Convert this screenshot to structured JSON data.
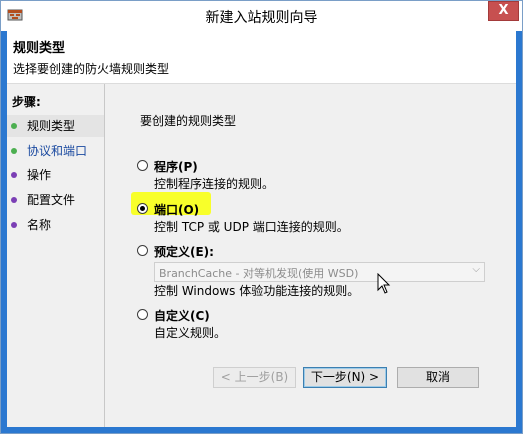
{
  "window": {
    "title": "新建入站规则向导",
    "close_glyph": "X"
  },
  "header": {
    "title": "规则类型",
    "subtitle": "选择要创建的防火墙规则类型"
  },
  "steps": {
    "title": "步骤:",
    "items": [
      {
        "label": "规则类型",
        "bullet_color": "#4caf50"
      },
      {
        "label": "协议和端口",
        "bullet_color": "#4caf50"
      },
      {
        "label": "操作",
        "bullet_color": "#7b3fb5"
      },
      {
        "label": "配置文件",
        "bullet_color": "#7b3fb5"
      },
      {
        "label": "名称",
        "bullet_color": "#7b3fb5"
      }
    ]
  },
  "content": {
    "prompt": "要创建的规则类型",
    "options": [
      {
        "label": "程序(P)",
        "desc": "控制程序连接的规则。",
        "checked": false
      },
      {
        "label": "端口(O)",
        "desc": "控制 TCP 或 UDP 端口连接的规则。",
        "checked": true
      },
      {
        "label": "预定义(E):",
        "desc": "控制 Windows 体验功能连接的规则。",
        "checked": false
      },
      {
        "label": "自定义(C)",
        "desc": "自定义规则。",
        "checked": false
      }
    ],
    "predefined_select": "BranchCache - 对等机发现(使用 WSD)",
    "highlight_color": "#f8ff2a"
  },
  "buttons": {
    "back": "< 上一步(B)",
    "next": "下一步(N) >",
    "cancel": "取消"
  }
}
